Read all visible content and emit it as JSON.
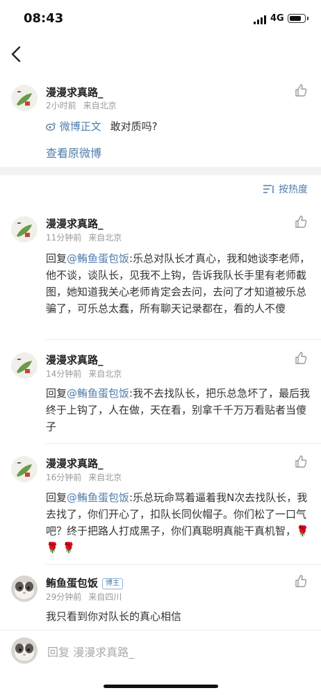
{
  "status_bar": {
    "time": "08:43",
    "network": "4G",
    "battery_level": 0.8
  },
  "post": {
    "author": "漫漫求真路_",
    "time": "2小时前",
    "source": "来自北京",
    "link_label": "微博正文",
    "text": "敢对质吗?",
    "view_original": "查看原微博"
  },
  "sort_label": "按热度",
  "comments": [
    {
      "author": "漫漫求真路_",
      "time": "11分钟前",
      "source": "来自北京",
      "reply_prefix": "回复",
      "mention": "@鲔鱼蛋包饭",
      "text": ":乐总对队长才真心，我和她谈李老师，他不谈，谈队长，见我不上钩，告诉我队长手里有老师截图，她知道我关心老师肯定会去问，去问了才知道被乐总骗了，可乐总太蠢，所有聊天记录都在，看的人不傻"
    },
    {
      "author": "漫漫求真路_",
      "time": "14分钟前",
      "source": "来自北京",
      "reply_prefix": "回复",
      "mention": "@鲔鱼蛋包饭",
      "text": ":我不去找队长，把乐总急坏了，最后我终于上钩了，人在做，天在看，别拿千千万万看贴者当傻子"
    },
    {
      "author": "漫漫求真路_",
      "time": "16分钟前",
      "source": "来自北京",
      "reply_prefix": "回复",
      "mention": "@鲔鱼蛋包饭",
      "text": ":乐总玩命骂着逼着我N次去找队长，我去找了，你们开心了，扣队长同伙帽子。你们松了一口气吧？终于把路人打成黑子，你们真聪明真能干真机智，",
      "emoji": "🌹 🌹 🌹"
    },
    {
      "author": "鲔鱼蛋包饭",
      "badge": "博主",
      "time": "29分钟前",
      "source": "来自四川",
      "text": "我只看到你对队长的真心相信"
    }
  ],
  "reply_bar": {
    "placeholder": "回复 漫漫求真路_"
  }
}
